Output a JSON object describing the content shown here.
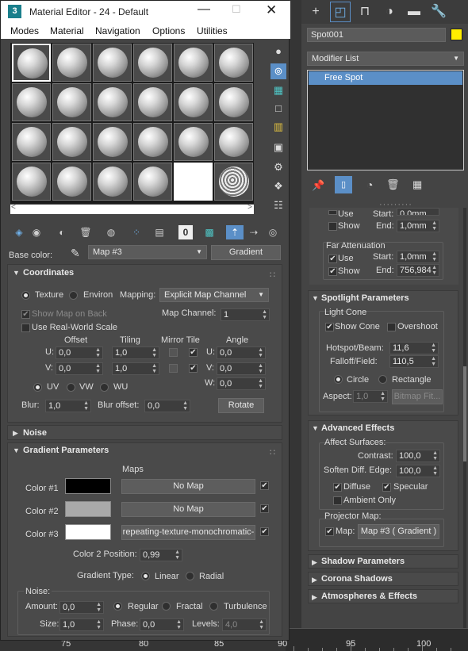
{
  "window": {
    "title": "Material Editor - 24 - Default",
    "app_icon": "3"
  },
  "menu": [
    "Modes",
    "Material",
    "Navigation",
    "Options",
    "Utilities"
  ],
  "base": {
    "label": "Base color:",
    "material_name": "Map #3",
    "type_button": "Gradient"
  },
  "coordinates": {
    "title": "Coordinates",
    "texture": "Texture",
    "environ": "Environ",
    "mapping_label": "Mapping:",
    "mapping_value": "Explicit Map Channel",
    "show_map_on_back": "Show Map on Back",
    "map_channel_label": "Map Channel:",
    "map_channel_value": "1",
    "real_world": "Use Real-World Scale",
    "offset": "Offset",
    "tiling": "Tiling",
    "mirror_tile": "Mirror Tile",
    "angle": "Angle",
    "u_label": "U:",
    "v_label": "V:",
    "w_label": "W:",
    "u_offset": "0,0",
    "v_offset": "0,0",
    "u_tiling": "1,0",
    "v_tiling": "1,0",
    "u_angle": "0,0",
    "v_angle": "0,0",
    "w_angle": "0,0",
    "uv": "UV",
    "vw": "VW",
    "wu": "WU",
    "blur_label": "Blur:",
    "blur": "1,0",
    "blur_offset_label": "Blur offset:",
    "blur_offset": "0,0",
    "rotate": "Rotate"
  },
  "noise_rollout": "Noise",
  "gradient": {
    "title": "Gradient Parameters",
    "maps": "Maps",
    "colors": [
      {
        "label": "Color #1",
        "color": "#000000",
        "map": "No Map"
      },
      {
        "label": "Color #2",
        "color": "#a9a9a9",
        "map": "No Map"
      },
      {
        "label": "Color #3",
        "color": "#ffffff",
        "map": "repeating-texture-monochromatic-"
      }
    ],
    "color2_pos_label": "Color 2 Position:",
    "color2_pos": "0,99",
    "type_label": "Gradient Type:",
    "linear": "Linear",
    "radial": "Radial",
    "noise_group": "Noise:",
    "amount_label": "Amount:",
    "amount": "0,0",
    "regular": "Regular",
    "fractal": "Fractal",
    "turbulence": "Turbulence",
    "size_label": "Size:",
    "size": "1,0",
    "phase_label": "Phase:",
    "phase": "0,0",
    "levels_label": "Levels:",
    "levels": "4,0"
  },
  "ruler": {
    "labels": [
      "75",
      "80",
      "85",
      "90",
      "95",
      "100"
    ]
  },
  "cmd": {
    "object_name": "Spot001",
    "object_color": "#ffee00",
    "modifier_list": "Modifier List",
    "stack_item": "Free Spot",
    "use": "Use",
    "show": "Show",
    "start_label": "Start:",
    "start_top": "0,0mm",
    "end_label": "End:",
    "end_top": "1,0mm",
    "far_att": "Far Attenuation",
    "far_start": "1,0mm",
    "far_end": "756,984",
    "spot_title": "Spotlight Parameters",
    "light_cone": "Light Cone",
    "show_cone": "Show Cone",
    "overshoot": "Overshoot",
    "hotspot_label": "Hotspot/Beam:",
    "hotspot": "11,6",
    "falloff_label": "Falloff/Field:",
    "falloff": "110,5",
    "circle": "Circle",
    "rectangle": "Rectangle",
    "aspect_label": "Aspect:",
    "aspect": "1,0",
    "bitmap_fit": "Bitmap Fit...",
    "adv_title": "Advanced Effects",
    "affect": "Affect Surfaces:",
    "contrast_label": "Contrast:",
    "contrast": "100,0",
    "soften_label": "Soften Diff. Edge:",
    "soften": "100,0",
    "diffuse": "Diffuse",
    "specular": "Specular",
    "ambient": "Ambient Only",
    "proj": "Projector Map:",
    "map_label": "Map:",
    "map_value": "Map #3 ( Gradient )",
    "shadow": "Shadow Parameters",
    "corona": "Corona Shadows",
    "atmos": "Atmospheres & Effects"
  }
}
